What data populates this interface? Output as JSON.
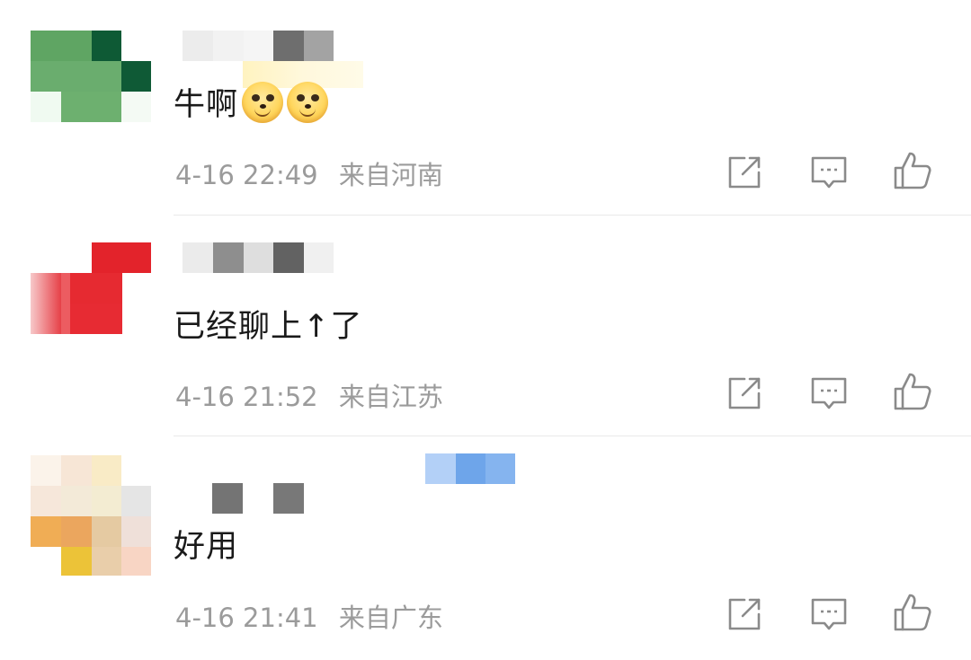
{
  "comments": [
    {
      "text": "牛啊",
      "emojis": [
        "doge-emoji",
        "doge-emoji"
      ],
      "date": "4-16",
      "time": "22:49",
      "location": "来自河南"
    },
    {
      "text": "已经聊上↑了",
      "date": "4-16",
      "time": "21:52",
      "location": "来自江苏"
    },
    {
      "text": "好用",
      "date": "4-16",
      "time": "21:41",
      "location": "来自广东"
    }
  ],
  "icons": {
    "share": "share-icon",
    "reply": "comment-icon",
    "like": "thumbs-up-icon"
  },
  "colors": {
    "text": "#1a1a1a",
    "meta": "#9b9b9b",
    "icon": "#8a8a8a",
    "divider": "#e9e9e9"
  }
}
